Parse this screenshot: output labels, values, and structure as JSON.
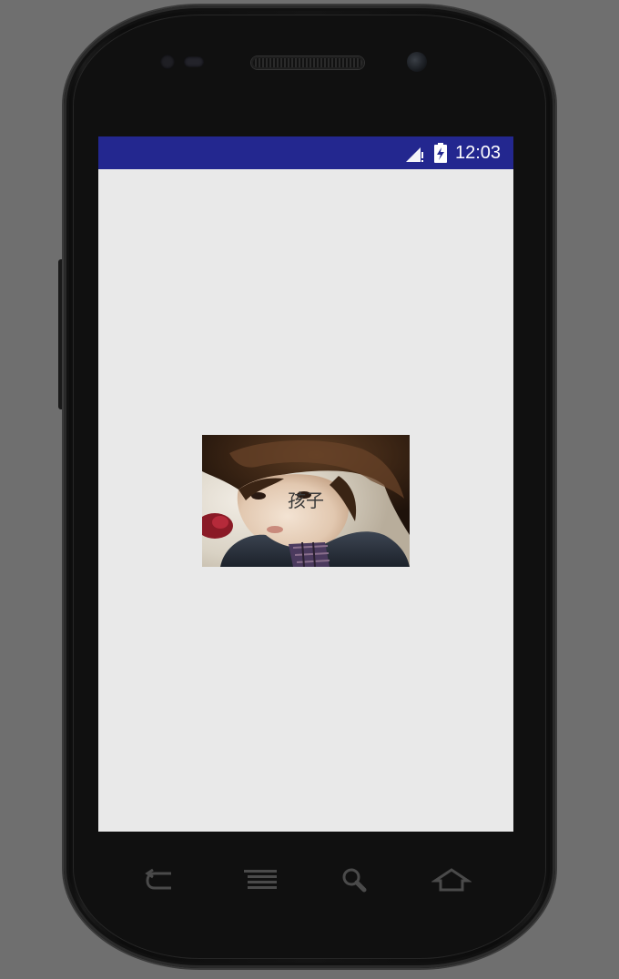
{
  "status_bar": {
    "time": "12:03",
    "background_color": "#23278f",
    "icons": [
      "signal-no-data-icon",
      "battery-charging-icon"
    ]
  },
  "content": {
    "image_caption": "孩子",
    "background_color": "#e9e9e9"
  },
  "navigation": {
    "keys": [
      "back-icon",
      "menu-icon",
      "search-icon",
      "home-icon"
    ]
  }
}
